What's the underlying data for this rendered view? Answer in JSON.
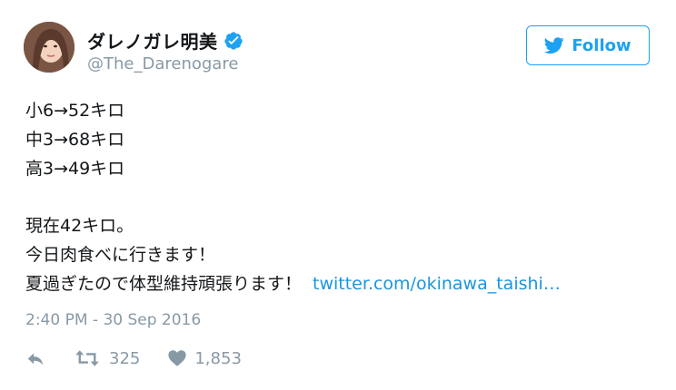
{
  "author": {
    "display_name": "ダレノガレ明美",
    "handle": "@The_Darenogare",
    "verified": true
  },
  "follow_button": {
    "label": "Follow"
  },
  "tweet": {
    "lines": [
      "小6→52キロ",
      "中3→68キロ",
      "高3→49キロ",
      "",
      "現在42キロ。",
      "今日肉食べに行きます！",
      "夏過ぎたので体型維持頑張ります！"
    ],
    "link_text": "twitter.com/okinawa_taishi…",
    "timestamp": "2:40 PM - 30 Sep 2016"
  },
  "actions": {
    "reply_icon": "reply-icon",
    "retweet_icon": "retweet-icon",
    "retweet_count": "325",
    "like_icon": "heart-icon",
    "like_count": "1,853"
  },
  "colors": {
    "accent": "#1da1f2",
    "link": "#1b95e0",
    "muted": "#8899a6",
    "text": "#14171a"
  }
}
